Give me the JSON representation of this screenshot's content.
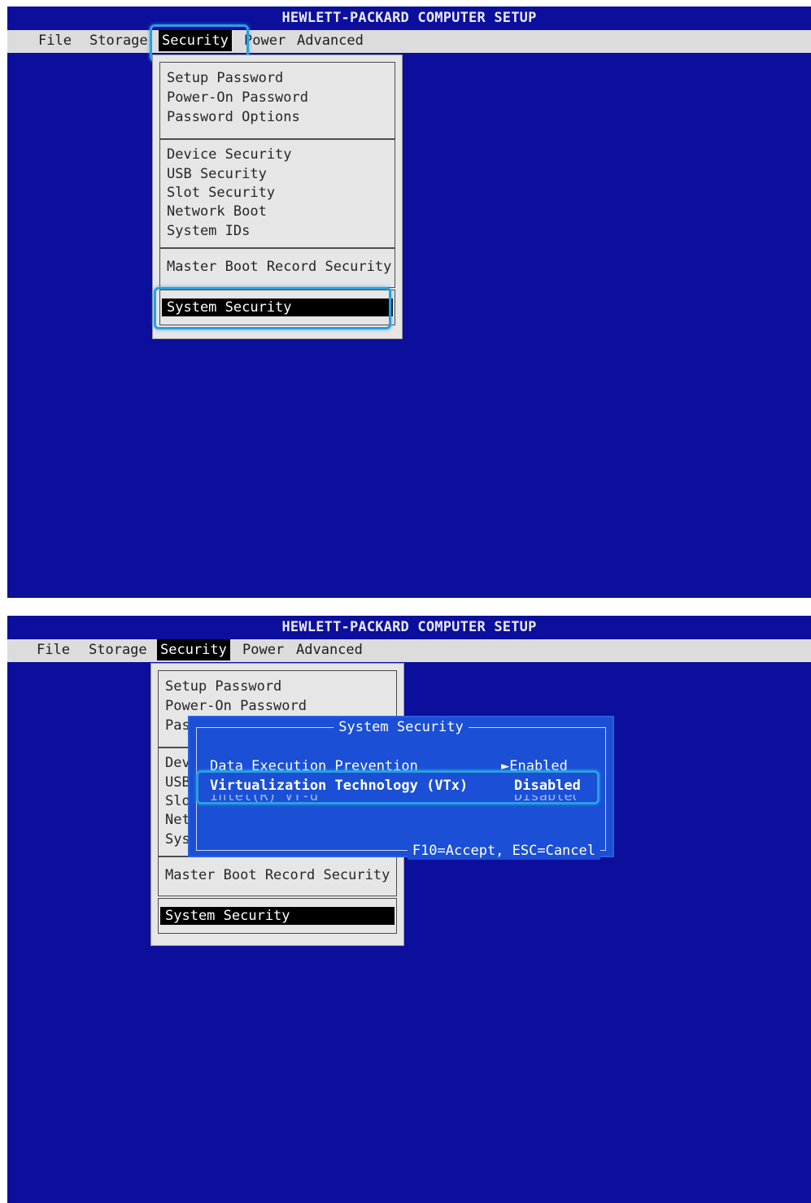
{
  "title": "HEWLETT-PACKARD COMPUTER SETUP",
  "menu": [
    "File",
    "Storage",
    "Security",
    "Power",
    "Advanced"
  ],
  "security_menu": {
    "group1": [
      "Setup Password",
      "Power-On Password",
      "Password Options"
    ],
    "group2": [
      "Device Security",
      "USB Security",
      "Slot Security",
      "Network Boot",
      "System IDs"
    ],
    "group3": [
      "Master Boot Record Security"
    ],
    "group4": [
      "System Security"
    ]
  },
  "partial_items": [
    "Pas",
    "Dev",
    "USB",
    "Slo",
    "Net",
    "Sys"
  ],
  "dialog": {
    "title": "System Security",
    "rows": [
      {
        "label": "Data Execution Prevention",
        "value": "►Enabled"
      },
      {
        "label": "Virtualization Technology (VTx)",
        "value": "Disabled"
      },
      {
        "label": "Intel(R) VT-d",
        "value": "Disabled"
      }
    ],
    "footer": "F10=Accept, ESC=Cancel"
  },
  "colors": {
    "screen_bg": "#0b0f9c",
    "menu_bg": "#dcdcdc",
    "dialog_bg": "#1a4fd6",
    "highlight": "#2a9fe0"
  }
}
